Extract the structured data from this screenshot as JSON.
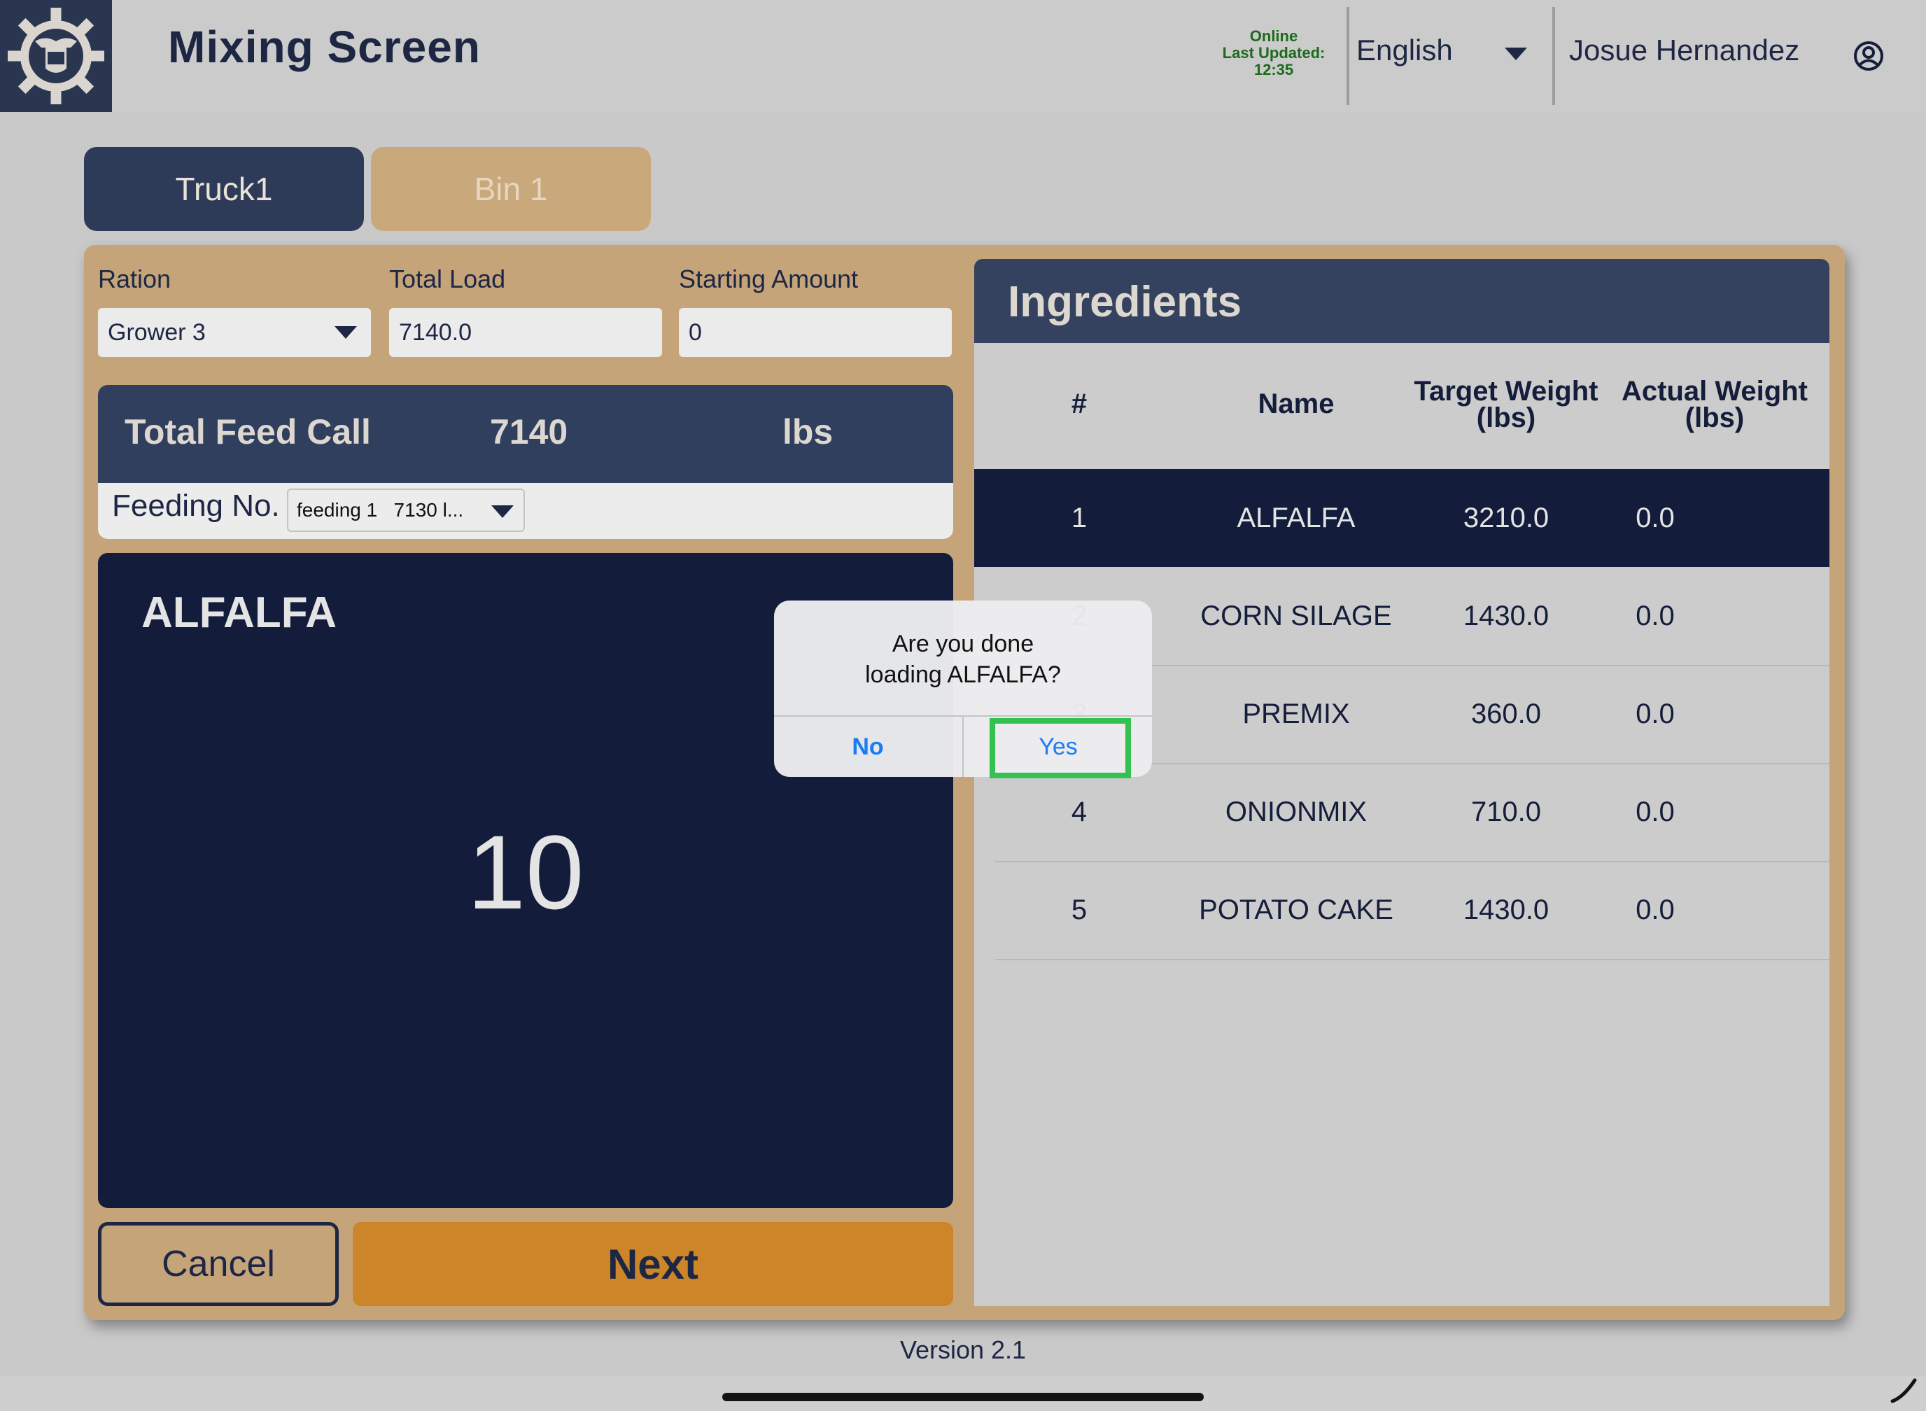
{
  "header": {
    "title": "Mixing Screen",
    "status": {
      "online": "Online",
      "last_updated_label": "Last Updated:",
      "last_updated_time": "12:35",
      "color": "#1c6b1c"
    },
    "language": "English",
    "user_name": "Josue Hernandez"
  },
  "tabs": [
    {
      "label": "Truck1",
      "active": true
    },
    {
      "label": "Bin 1",
      "active": false
    }
  ],
  "form": {
    "ration_label": "Ration",
    "ration_value": "Grower 3",
    "total_load_label": "Total Load",
    "total_load_value": "7140.0",
    "starting_amount_label": "Starting Amount",
    "starting_amount_value": "0"
  },
  "feed_call": {
    "label": "Total Feed Call",
    "value": "7140",
    "unit": "lbs",
    "feeding_label": "Feeding No.",
    "feeding_value": "feeding 1   7130 l..."
  },
  "current": {
    "ingredient": "ALFALFA",
    "value": "10"
  },
  "buttons": {
    "cancel": "Cancel",
    "next": "Next"
  },
  "ingredients": {
    "title": "Ingredients",
    "columns": {
      "num": "#",
      "name": "Name",
      "target": "Target Weight (lbs)",
      "actual": "Actual Weight (lbs)"
    },
    "rows": [
      {
        "num": "1",
        "name": "ALFALFA",
        "target": "3210.0",
        "actual": "0.0",
        "selected": true
      },
      {
        "num": "2",
        "name": "CORN SILAGE",
        "target": "1430.0",
        "actual": "0.0"
      },
      {
        "num": "3",
        "name": "PREMIX",
        "target": "360.0",
        "actual": "0.0"
      },
      {
        "num": "4",
        "name": "ONIONMIX",
        "target": "710.0",
        "actual": "0.0"
      },
      {
        "num": "5",
        "name": "POTATO CAKE",
        "target": "1430.0",
        "actual": "0.0"
      }
    ]
  },
  "dialog": {
    "message_line1": "Are you done",
    "message_line2": "loading ALFALFA?",
    "no_label": "No",
    "yes_label": "Yes",
    "highlight_color": "#33c14f"
  },
  "footer": {
    "version": "Version 2.1"
  },
  "colors": {
    "navy": "#131d3b",
    "tan": "#c6a47a",
    "orange": "#cd8529",
    "slate": "#313f5e"
  }
}
